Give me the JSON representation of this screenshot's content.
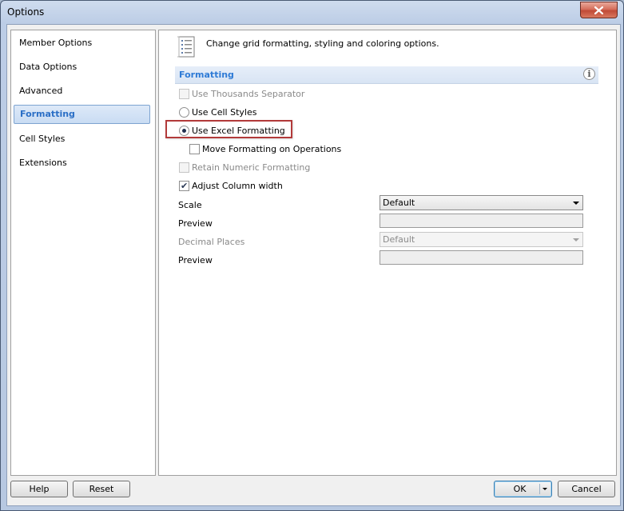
{
  "window": {
    "title": "Options"
  },
  "sidebar": {
    "items": [
      {
        "label": "Member Options",
        "active": false
      },
      {
        "label": "Data Options",
        "active": false
      },
      {
        "label": "Advanced",
        "active": false
      },
      {
        "label": "Formatting",
        "active": true
      },
      {
        "label": "Cell Styles",
        "active": false
      },
      {
        "label": "Extensions",
        "active": false
      }
    ]
  },
  "content": {
    "header_text": "Change grid formatting, styling and coloring options.",
    "section_title": "Formatting",
    "options": {
      "use_thousands_separator": {
        "label": "Use Thousands Separator",
        "checked": false,
        "enabled": false
      },
      "use_cell_styles": {
        "label": "Use Cell Styles",
        "selected": false
      },
      "use_excel_formatting": {
        "label": "Use Excel Formatting",
        "selected": true
      },
      "move_formatting": {
        "label": "Move Formatting on Operations",
        "checked": false,
        "enabled": true
      },
      "retain_numeric_formatting": {
        "label": "Retain Numeric Formatting",
        "checked": false,
        "enabled": false
      },
      "adjust_column_width": {
        "label": "Adjust Column width",
        "checked": true,
        "enabled": true
      }
    },
    "fields": {
      "scale_label": "Scale",
      "scale_value": "Default",
      "preview1_label": "Preview",
      "preview1_value": "",
      "decimal_places_label": "Decimal Places",
      "decimal_places_value": "Default",
      "preview2_label": "Preview",
      "preview2_value": ""
    }
  },
  "buttons": {
    "help": "Help",
    "reset": "Reset",
    "ok": "OK",
    "cancel": "Cancel"
  },
  "colors": {
    "accent_text": "#2f7bd6",
    "highlight_border": "#b23a3a",
    "close_button": "#c04a36"
  },
  "icons": {
    "close": "close-icon",
    "header": "list-settings-icon",
    "info": "info-icon",
    "dropdown": "chevron-down-icon"
  }
}
